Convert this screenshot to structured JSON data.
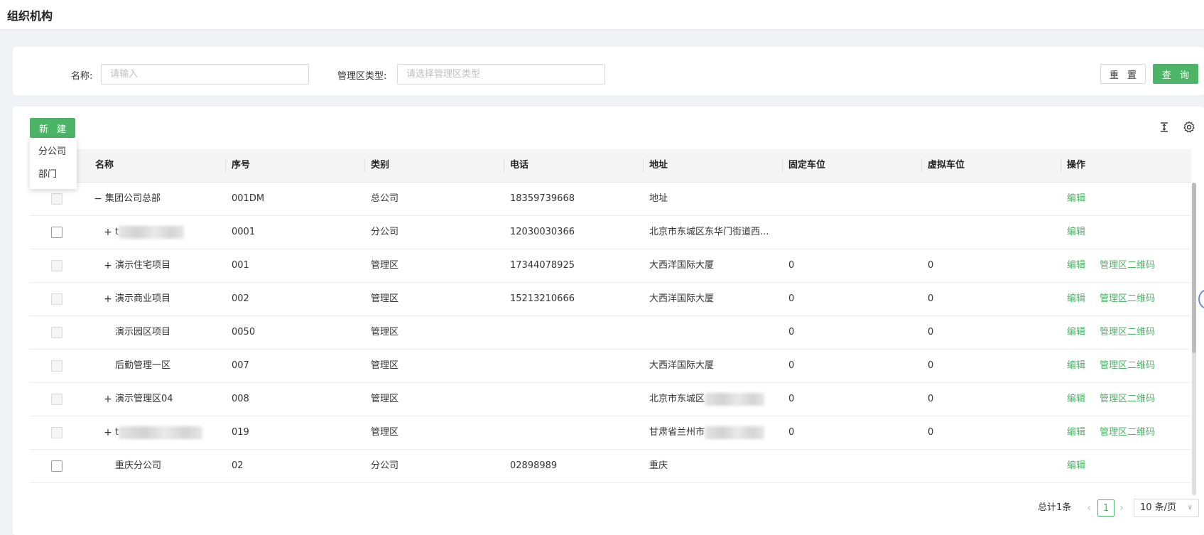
{
  "page": {
    "title": "组织机构"
  },
  "search": {
    "name_label": "名称:",
    "name_placeholder": "请输入",
    "type_label": "管理区类型:",
    "type_placeholder": "请选择管理区类型",
    "reset_label": "重 置",
    "query_label": "查 询"
  },
  "toolbar": {
    "new_label": "新 建",
    "dropdown": [
      "分公司",
      "部门"
    ],
    "density_icon": "column-height-icon",
    "settings_icon": "gear-icon"
  },
  "table": {
    "columns": [
      "名称",
      "序号",
      "类别",
      "电话",
      "地址",
      "固定车位",
      "虚拟车位",
      "操作"
    ],
    "rows": [
      {
        "name": "集团公司总部",
        "expander": "−",
        "level": 0,
        "serial": "001DM",
        "category": "总公司",
        "phone": "18359739668",
        "address": "地址",
        "fixed": "",
        "virtual": "",
        "actions": [
          "编辑"
        ],
        "checkbox_disabled": true
      },
      {
        "name": "t",
        "name_blur": true,
        "expander": "+",
        "level": 1,
        "serial": "0001",
        "category": "分公司",
        "phone": "12030030366",
        "address": "北京市东城区东华门街道西...",
        "fixed": "",
        "virtual": "",
        "actions": [
          "编辑"
        ],
        "checkbox_disabled": false
      },
      {
        "name": "演示住宅项目",
        "expander": "+",
        "level": 1,
        "serial": "001",
        "category": "管理区",
        "phone": "17344078925",
        "address": "大西洋国际大厦",
        "fixed": "0",
        "virtual": "0",
        "actions": [
          "编辑",
          "管理区二维码"
        ],
        "checkbox_disabled": true
      },
      {
        "name": "演示商业项目",
        "expander": "+",
        "level": 1,
        "serial": "002",
        "category": "管理区",
        "phone": "15213210666",
        "address": "大西洋国际大厦",
        "fixed": "0",
        "virtual": "0",
        "actions": [
          "编辑",
          "管理区二维码"
        ],
        "checkbox_disabled": true
      },
      {
        "name": "演示园区项目",
        "expander": "",
        "level": 1,
        "serial": "0050",
        "category": "管理区",
        "phone": "",
        "address": "",
        "fixed": "0",
        "virtual": "0",
        "actions": [
          "编辑",
          "管理区二维码"
        ],
        "checkbox_disabled": true
      },
      {
        "name": "后勤管理一区",
        "expander": "",
        "level": 1,
        "serial": "007",
        "category": "管理区",
        "phone": "",
        "address": "大西洋国际大厦",
        "fixed": "0",
        "virtual": "0",
        "actions": [
          "编辑",
          "管理区二维码"
        ],
        "checkbox_disabled": true
      },
      {
        "name": "演示管理区04",
        "expander": "+",
        "level": 1,
        "serial": "008",
        "category": "管理区",
        "phone": "",
        "address": "北京市东城区",
        "address_blur": true,
        "fixed": "0",
        "virtual": "0",
        "actions": [
          "编辑",
          "管理区二维码"
        ],
        "checkbox_disabled": true
      },
      {
        "name": "t",
        "name_blur": true,
        "expander": "+",
        "level": 1,
        "serial": "019",
        "category": "管理区",
        "phone": "",
        "address": "甘肃省兰州市",
        "address_blur": true,
        "fixed": "0",
        "virtual": "0",
        "actions": [
          "编辑",
          "管理区二维码"
        ],
        "checkbox_disabled": true
      },
      {
        "name": "重庆分公司",
        "expander": "",
        "level": 1,
        "serial": "02",
        "category": "分公司",
        "phone": "02898989",
        "address": "重庆",
        "fixed": "",
        "virtual": "",
        "actions": [
          "编辑"
        ],
        "checkbox_disabled": false
      }
    ]
  },
  "pagination": {
    "total": "总计1条",
    "current": "1",
    "prev": "‹",
    "next": "›",
    "page_size": "10 条/页",
    "chevron": "∨"
  },
  "colors": {
    "accent": "#4cb466",
    "background": "#f0f2f5"
  }
}
